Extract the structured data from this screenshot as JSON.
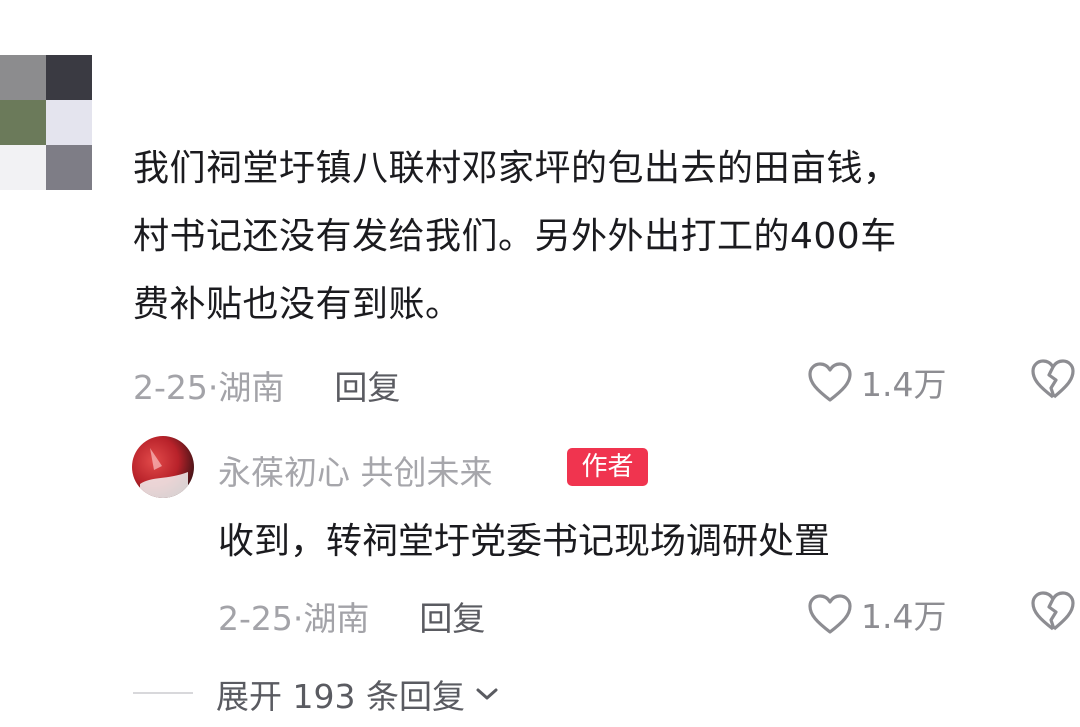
{
  "comment": {
    "lines": [
      "我们祠堂圩镇八联村邓家坪的包出去的田亩钱，",
      "村书记还没有发给我们。另外外出打工的400车",
      "费补贴也没有到账。"
    ],
    "date": "2-25·湖南",
    "reply_label": "回复",
    "likes": "1.4万"
  },
  "reply": {
    "author": "永葆初心  共创未来",
    "author_badge": "作者",
    "text": "收到，转祠堂圩党委书记现场调研处置",
    "date": "2-25·湖南",
    "reply_label": "回复",
    "likes": "1.4万"
  },
  "expand_label": "展开 193 条回复",
  "icons": {
    "like": "heart-outline-icon",
    "dislike": "broken-heart-icon",
    "expand": "chevron-down-icon"
  },
  "colors": {
    "author_badge": "#f0344f",
    "meta_text": "#a3a3a8"
  }
}
